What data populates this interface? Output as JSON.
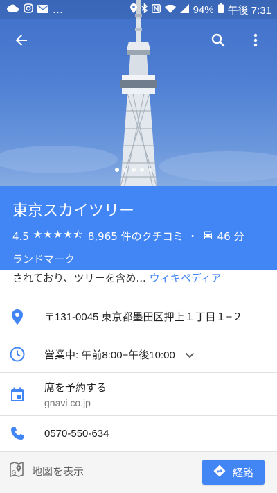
{
  "status_bar": {
    "battery": "94%",
    "time": "午後 7:31",
    "ellipsis": "…"
  },
  "place": {
    "name": "東京スカイツリー",
    "rating": "4.5",
    "stars": "★★★★⯪",
    "reviews": "8,965 件のクチコミ",
    "separator": "・",
    "drive_time": "46 分",
    "category": "ランドマーク"
  },
  "description": {
    "snippet": "されており、ツリーを含め...",
    "link": "ウィキペディア"
  },
  "info": {
    "address": "〒131-0045 東京都墨田区押上１丁目１−２",
    "hours": "営業中: 午前8:00−午後10:00",
    "reserve_title": "席を予約する",
    "reserve_sub": "gnavi.co.jp",
    "phone": "0570-550-634"
  },
  "bottom": {
    "show_map": "地図を表示",
    "route": "経路"
  },
  "carousel": {
    "count": 5,
    "active_index": 0
  },
  "colors": {
    "accent": "#4285f4",
    "title_panel": "#4285f4",
    "sky": "#4f80d4"
  }
}
